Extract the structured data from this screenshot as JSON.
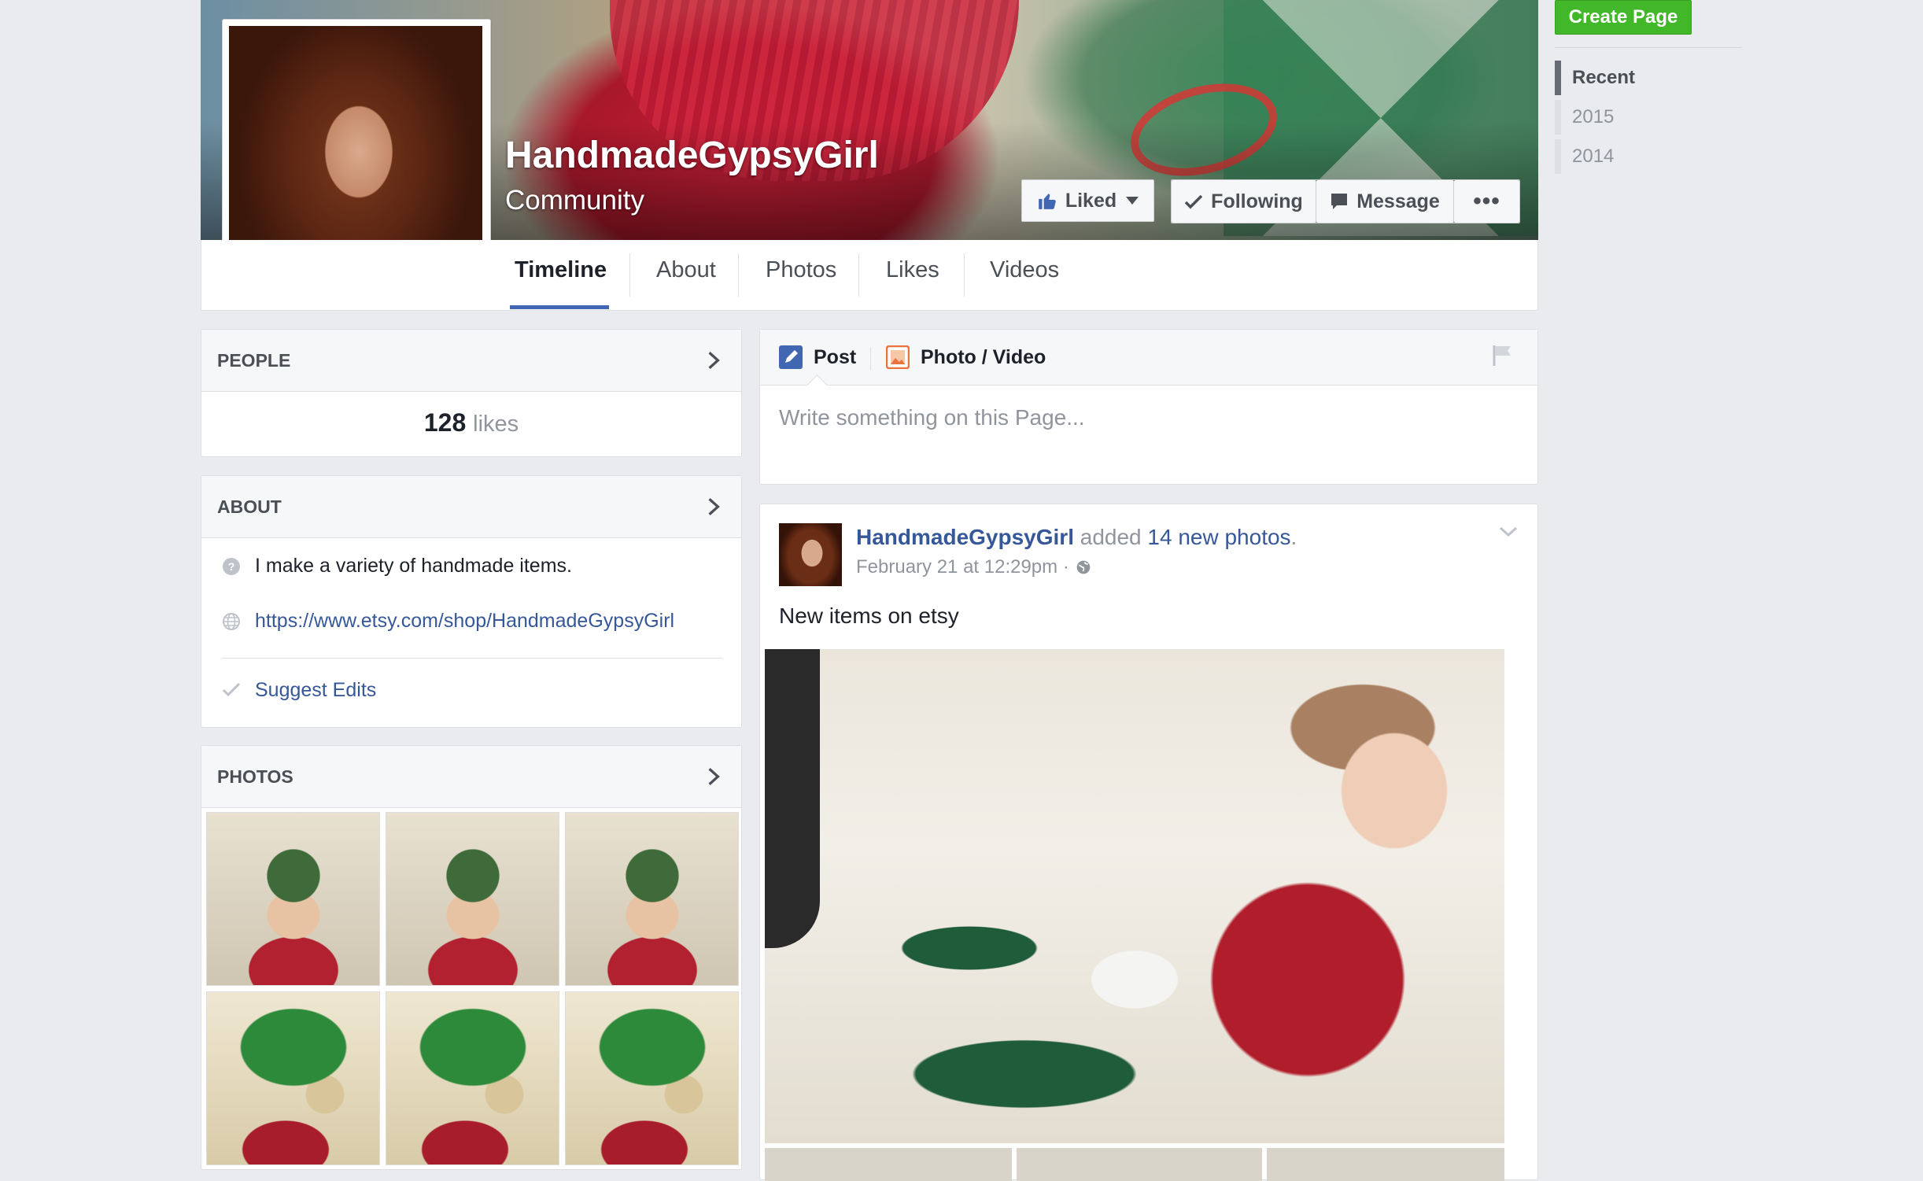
{
  "page": {
    "name": "HandmadeGypsyGirl",
    "category": "Community"
  },
  "actions": {
    "liked": "Liked",
    "following": "Following",
    "message": "Message",
    "more": "•••"
  },
  "tabs": [
    {
      "label": "Timeline",
      "active": true
    },
    {
      "label": "About"
    },
    {
      "label": "Photos"
    },
    {
      "label": "Likes"
    },
    {
      "label": "Videos"
    }
  ],
  "people": {
    "title": "PEOPLE",
    "likes_count": "128",
    "likes_label": "likes"
  },
  "about": {
    "title": "ABOUT",
    "description": "I make a variety of handmade items.",
    "link": "https://www.etsy.com/shop/HandmadeGypsyGirl",
    "suggest_edits": "Suggest Edits"
  },
  "photos": {
    "title": "PHOTOS"
  },
  "composer": {
    "post_tab": "Post",
    "photo_tab": "Photo / Video",
    "placeholder": "Write something on this Page..."
  },
  "post": {
    "author": "HandmadeGypsyGirl",
    "action": " added ",
    "object": "14 new photos",
    "period": ".",
    "timestamp": "February 21 at 12:29pm ·",
    "text": "New items on etsy"
  },
  "sidebar": {
    "create_page": "Create Page",
    "years": [
      "Recent",
      "2015",
      "2014"
    ]
  },
  "colors": {
    "link": "#365899",
    "accent": "#4267b2",
    "create_page_green": "#42b72a"
  }
}
